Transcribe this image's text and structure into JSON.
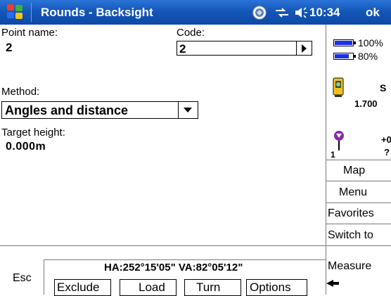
{
  "titlebar": {
    "title": "Rounds - Backsight",
    "time": "10:34",
    "ok_label": "ok",
    "start_icon": "windows-flag-icon",
    "status_icons": [
      "connectivity-icon",
      "sync-arrows-icon",
      "speaker-icon"
    ]
  },
  "form": {
    "point_name_label": "Point name:",
    "point_name_value": "2",
    "code_label": "Code:",
    "code_value": "2",
    "method_label": "Method:",
    "method_value": "Angles and distance",
    "target_height_label": "Target height:",
    "target_height_value": "0.000m"
  },
  "status_panel": {
    "battery1_pct": "100%",
    "battery1_level": 1.0,
    "battery2_pct": "80%",
    "battery2_level": 0.8,
    "instrument_text_1": "S",
    "instrument_text_2": "1.700",
    "target_text_1": "+0",
    "target_text_2": "?",
    "target_number": "1",
    "buttons": [
      "Map",
      "Menu",
      "Favorites",
      "Switch to",
      "Measure"
    ]
  },
  "bottom": {
    "esc_label": "Esc",
    "angles": "HA:252°15'05\"  VA:82°05'12\"",
    "buttons": [
      "Exclude",
      "Load",
      "Turn",
      "Options"
    ]
  },
  "colors": {
    "titlebar": "#1457b8",
    "battery_fill": "#1a32e6",
    "rod_purple": "#8a2aa8"
  }
}
